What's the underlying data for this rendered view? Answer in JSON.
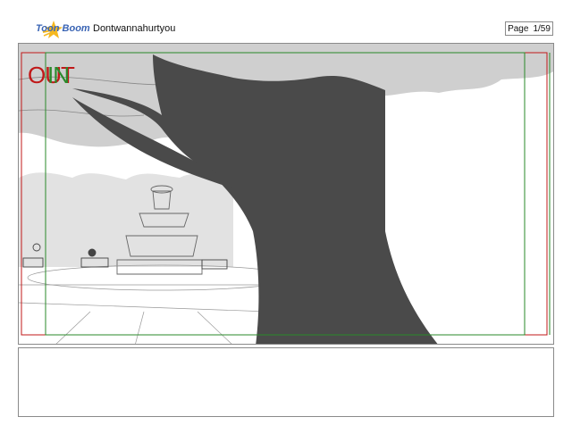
{
  "header": {
    "brand": "Toon Boom",
    "doc_title": "Dontwannahurtyou",
    "page_label": "Page",
    "page_value": "1/59"
  },
  "panel": {
    "out_label": "OUT",
    "in_label": "IN",
    "frame_colors": {
      "out": "#c01818",
      "in": "#2a8a2a"
    },
    "tree_color": "#4a4a4a",
    "foliage_color": "#cfcfcf"
  },
  "icons": {
    "logo": "toon-boom-star-icon"
  }
}
